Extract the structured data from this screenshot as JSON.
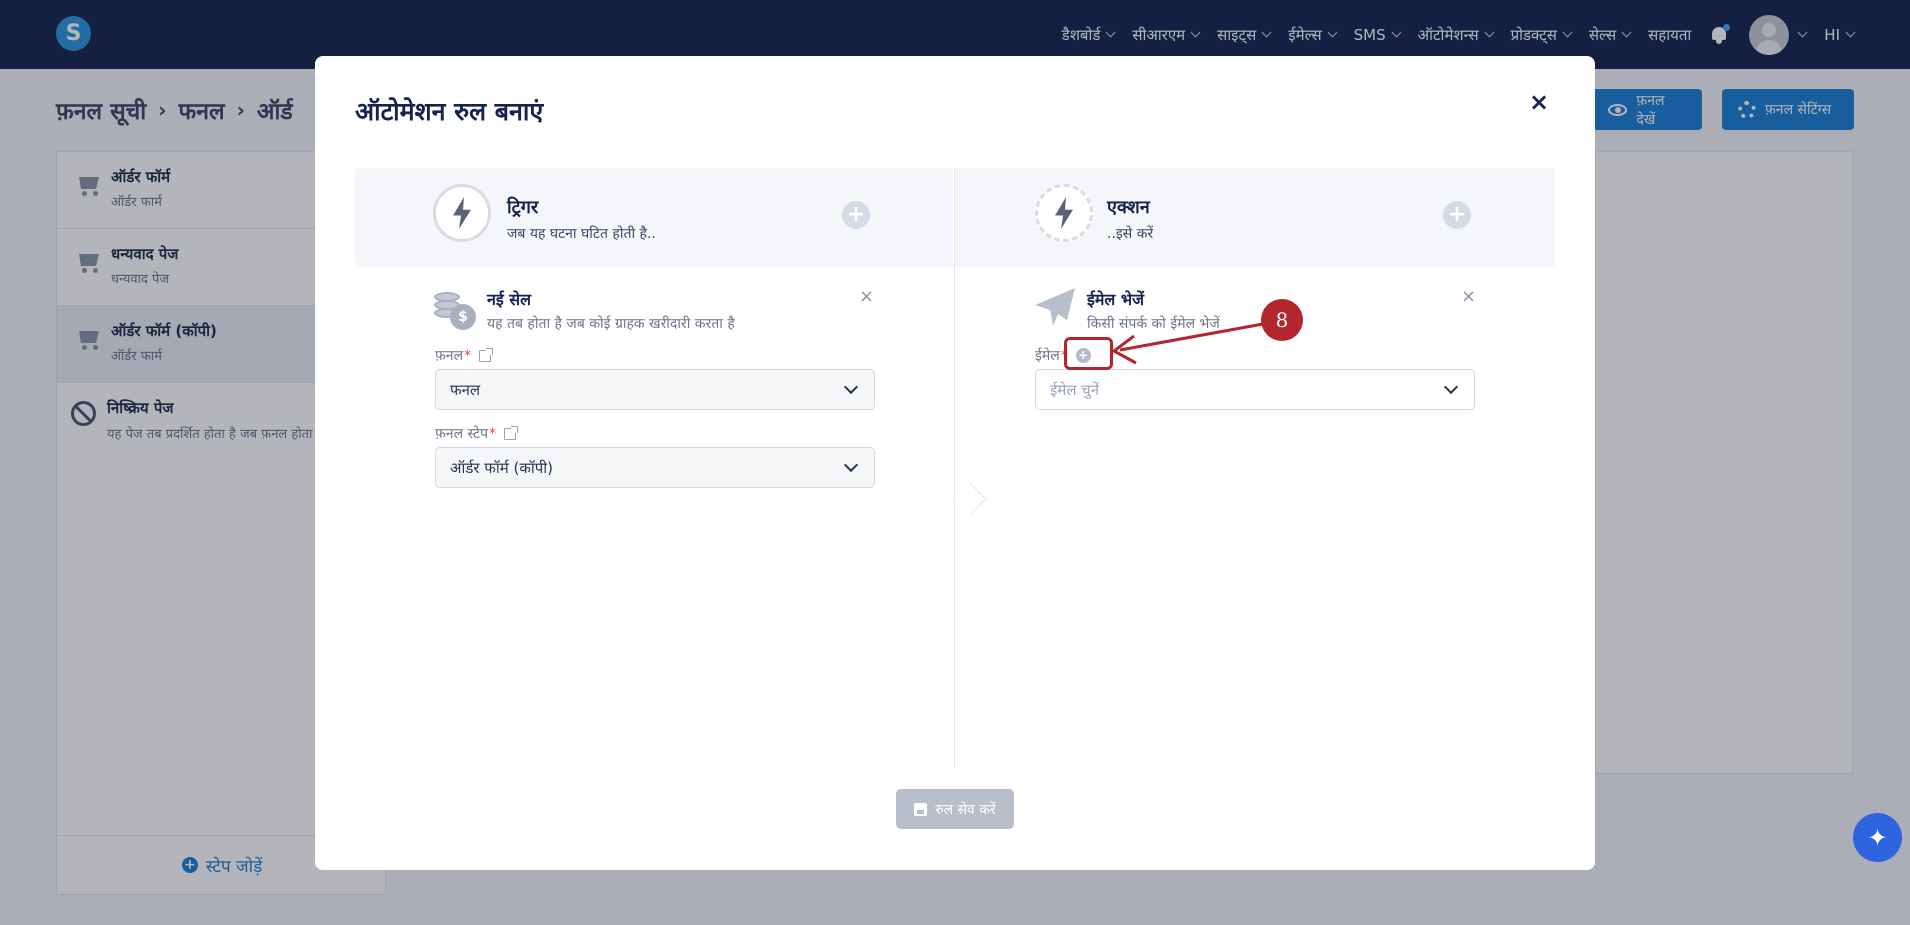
{
  "app": {
    "logo_letter": "S",
    "nav": [
      {
        "label": "डैशबोर्ड"
      },
      {
        "label": "सीआरएम"
      },
      {
        "label": "साइट्स"
      },
      {
        "label": "ईमेल्स"
      },
      {
        "label": "SMS"
      },
      {
        "label": "ऑटोमेशन्स"
      },
      {
        "label": "प्रोडक्ट्स"
      },
      {
        "label": "सेल्स"
      }
    ],
    "help_label": "सहायता",
    "lang_label": "HI"
  },
  "page": {
    "breadcrumb": [
      "फ़नल सूची",
      "फनल",
      "ऑर्ड"
    ],
    "view_funnel_label": "फ़नल देखें",
    "funnel_settings_label": "फ़नल सेटिंग्स",
    "steps": [
      {
        "title": "ऑर्डर फॉर्म",
        "subtitle": "ऑर्डर फार्म"
      },
      {
        "title": "धन्यवाद पेज",
        "subtitle": "धन्यवाद पेज"
      },
      {
        "title": "ऑर्डर फॉर्म (कॉपी)",
        "subtitle": "ऑर्डर फार्म"
      }
    ],
    "inactive_step": {
      "title": "निष्क्रिय पेज",
      "subtitle": "यह पेज तब प्रदर्शित होता है जब फ़नल होता है"
    },
    "add_step_label": "स्टेप जोड़ें"
  },
  "modal": {
    "title": "ऑटोमेशन रुल बनाएं",
    "close_symbol": "×",
    "trigger": {
      "title": "ट्रिगर",
      "subtitle": "जब यह घटना घटित होती है.."
    },
    "action": {
      "title": "एक्शन",
      "subtitle": "..इसे करें"
    },
    "trigger_item": {
      "title": "नई सेल",
      "subtitle": "यह तब होता है जब कोई ग्राहक खरीदारी करता है",
      "funnel_label": "फ़नल",
      "funnel_value": "फनल",
      "funnel_step_label": "फ़नल स्टेप",
      "funnel_step_value": "ऑर्डर फॉर्म (कॉपी)"
    },
    "action_item": {
      "title": "ईमेल भेजें",
      "subtitle": "किसी संपर्क को ईमेल भेजें",
      "email_label": "ईमेल",
      "email_placeholder": "ईमेल चुनें"
    },
    "required_mark": "*",
    "remove_symbol": "×",
    "plus_symbol": "+",
    "save_label": "रुल सेव करें"
  },
  "annotation": {
    "badge_number": "8",
    "color": "#b3262e"
  },
  "colors": {
    "nav_bg": "#15234f",
    "primary": "#1b7ed6",
    "disabled": "#b8bfcb"
  }
}
